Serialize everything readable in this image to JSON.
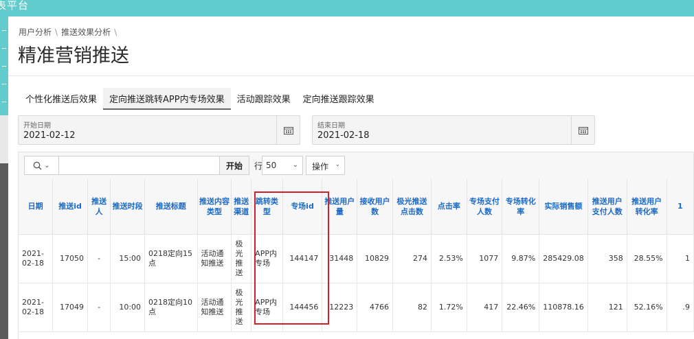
{
  "app": {
    "title": "表平台"
  },
  "breadcrumb": [
    "用户分析",
    "推送效果分析"
  ],
  "page_title": "精准营销推送",
  "tabs": [
    {
      "label": "个性化推送后效果",
      "active": false
    },
    {
      "label": "定向推送跳转APP内专场效果",
      "active": true
    },
    {
      "label": "活动跟踪效果",
      "active": false
    },
    {
      "label": "定向推送跟踪效果",
      "active": false
    }
  ],
  "filters": {
    "start": {
      "label": "开始日期",
      "value": "2021-02-12",
      "icon": "calendar-icon"
    },
    "end": {
      "label": "结束日期",
      "value": "2021-02-18",
      "icon": "calendar-icon"
    }
  },
  "toolbar": {
    "search_icon": "search-icon",
    "search_value": "",
    "go_label": "开始",
    "rows_label": "行",
    "rows_value": "50",
    "actions_label": "操作"
  },
  "table": {
    "columns": [
      "日期",
      "推送id",
      "推送人",
      "推送时段",
      "推送标题",
      "推送内容类型",
      "推送渠道",
      "跳转类型",
      "专场id",
      "推送用户量",
      "接收用户数",
      "极光推送点击数",
      "点击率",
      "专场支付人数",
      "专场转化率",
      "实际销售额",
      "推送用户支付人数",
      "推送用户转化率",
      "1"
    ],
    "rows": [
      [
        "2021-02-18",
        "17050",
        "-",
        "15:00",
        "0218定向15点",
        "活动通知推送",
        "极光推送",
        "APP内专场",
        "144147",
        "31448",
        "10829",
        "274",
        "2.53%",
        "1077",
        "9.87%",
        "285429.08",
        "358",
        "28.55%",
        "1"
      ],
      [
        "2021-02-18",
        "17049",
        "-",
        "10:00",
        "0218定向10点",
        "活动通知推送",
        "极光推送",
        "APP内专场",
        "144456",
        "12223",
        "4766",
        "82",
        "1.72%",
        "417",
        "22.46%",
        "110878.16",
        "121",
        "52.16%",
        ".9"
      ]
    ]
  },
  "colors": {
    "accent": "#62cbcd",
    "header_text": "#1b6ac9",
    "highlight": "#d0202a"
  }
}
